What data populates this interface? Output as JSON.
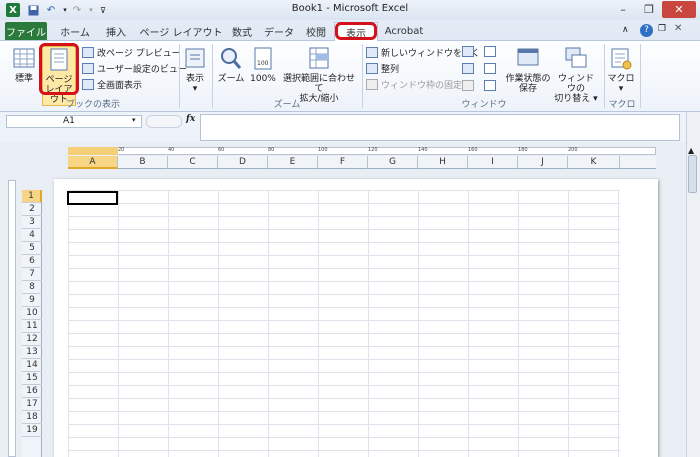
{
  "window": {
    "title": "Book1 - Microsoft Excel"
  },
  "tabs": [
    "ファイル",
    "ホーム",
    "挿入",
    "ページ レイアウト",
    "数式",
    "データ",
    "校閲",
    "表示",
    "Acrobat"
  ],
  "ribbon": {
    "group1": {
      "label": "ブックの表示",
      "normal": "標準",
      "page_layout_1": "ページ",
      "page_layout_2": "レイアウト",
      "page_break": "改ページ プレビュー",
      "custom_view": "ユーザー設定のビュー",
      "full_screen": "全画面表示"
    },
    "show": {
      "label": "表示"
    },
    "zoom": {
      "label": "ズーム",
      "zoom": "ズーム",
      "hundred": "100%",
      "fit_1": "選択範囲に合わせて",
      "fit_2": "拡大/縮小"
    },
    "window": {
      "label": "ウィンドウ",
      "new_window": "新しいウィンドウを開く",
      "arrange": "整列",
      "freeze": "ウィンドウ枠の固定",
      "save_ws_1": "作業状態の",
      "save_ws_2": "保存",
      "switch_1": "ウィンドウの",
      "switch_2": "切り替え"
    },
    "macro": {
      "label": "マクロ",
      "macro": "マクロ"
    }
  },
  "formula_bar": {
    "name_box": "A1",
    "fx": "fx",
    "value": ""
  },
  "ruler_marks": [
    "20",
    "40",
    "60",
    "80",
    "100",
    "120",
    "140",
    "160",
    "180",
    "200"
  ],
  "columns": [
    "A",
    "B",
    "C",
    "D",
    "E",
    "F",
    "G",
    "H",
    "I",
    "J",
    "K"
  ],
  "rows": [
    "1",
    "2",
    "3",
    "4",
    "5",
    "6",
    "7",
    "8",
    "9",
    "10",
    "11",
    "12",
    "13",
    "14",
    "15",
    "16",
    "17",
    "18",
    "19"
  ]
}
